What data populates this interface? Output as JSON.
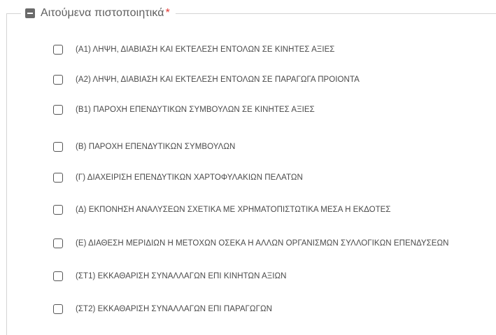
{
  "section": {
    "title": "Αιτούμενα πιστοποιητικά",
    "required_marker": "*",
    "icon": "collapse-minus-icon"
  },
  "options": [
    {
      "label": "(Α1) ΛΗΨΗ, ΔΙΑΒΙΑΣΗ ΚΑΙ ΕΚΤΕΛΕΣΗ ΕΝΤΟΛΩΝ ΣΕ ΚΙΝΗΤΕΣ ΑΞΙΕΣ",
      "checked": false
    },
    {
      "label": "(Α2) ΛΗΨΗ, ΔΙΑΒΙΑΣΗ ΚΑΙ ΕΚΤΕΛΕΣΗ ΕΝΤΟΛΩΝ ΣΕ ΠΑΡΑΓΩΓΑ ΠΡΟΙΟΝΤΑ",
      "checked": false
    },
    {
      "label": "(Β1) ΠΑΡΟΧΗ ΕΠΕΝΔΥΤΙΚΩΝ ΣΥΜΒΟΥΛΩΝ ΣΕ ΚΙΝΗΤΕΣ ΑΞΙΕΣ",
      "checked": false
    },
    {
      "label": "(Β) ΠΑΡΟΧΗ ΕΠΕΝΔΥΤΙΚΩΝ ΣΥΜΒΟΥΛΩΝ",
      "checked": false
    },
    {
      "label": "(Γ) ΔΙΑΧΕΙΡΙΣΗ ΕΠΕΝΔΥΤΙΚΩΝ ΧΑΡΤΟΦΥΛΑΚΙΩΝ ΠΕΛΑΤΩΝ",
      "checked": false
    },
    {
      "label": "(Δ) ΕΚΠΟΝΗΣΗ ΑΝΑΛΥΣΕΩΝ ΣΧΕΤΙΚΑ ΜΕ ΧΡΗΜΑΤΟΠΙΣΤΩΤΙΚΑ ΜΕΣΑ Η ΕΚΔΟΤΕΣ",
      "checked": false
    },
    {
      "label": "(Ε) ΔΙΑΘΕΣΗ ΜΕΡΙΔΙΩΝ Η ΜΕΤΟΧΩΝ ΟΣΕΚΑ Η ΑΛΛΩΝ ΟΡΓΑΝΙΣΜΩΝ ΣΥΛΛΟΓΙΚΩΝ ΕΠΕΝΔΥΣΕΩΝ",
      "checked": false
    },
    {
      "label": "(ΣΤ1) ΕΚΚΑΘΑΡΙΣΗ ΣΥΝΑΛΛΑΓΩΝ ΕΠΙ ΚΙΝΗΤΩΝ ΑΞΙΩΝ",
      "checked": false
    },
    {
      "label": "(ΣΤ2) ΕΚΚΑΘΑΡΙΣΗ ΣΥΝΑΛΛΑΓΩΝ ΕΠΙ ΠΑΡΑΓΩΓΩΝ",
      "checked": false
    }
  ]
}
